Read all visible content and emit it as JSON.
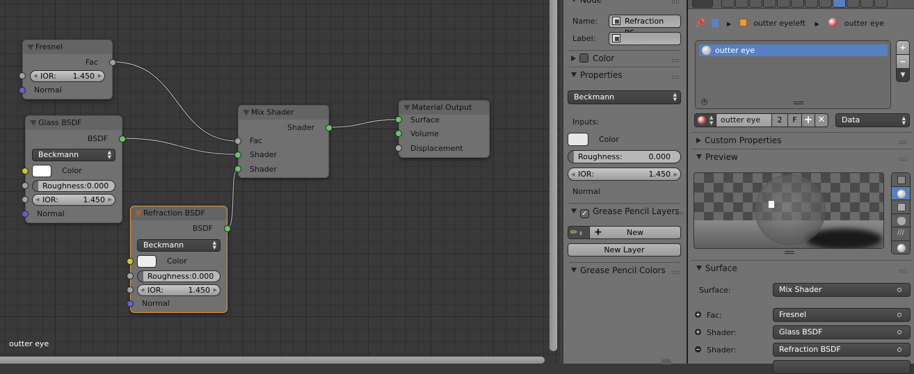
{
  "editor": {
    "material_label": "outter eye",
    "nodes": {
      "fresnel": {
        "title": "Fresnel",
        "out_fac": "Fac",
        "ior_label": "IOR:",
        "ior_value": "1.450",
        "normal": "Normal"
      },
      "glass": {
        "title": "Glass BSDF",
        "out": "BSDF",
        "distribution": "Beckmann",
        "color_label": "Color",
        "color": "#ffffff",
        "roughness_label": "Roughness:",
        "roughness_value": "0.000",
        "ior_label": "IOR:",
        "ior_value": "1.450",
        "normal": "Normal"
      },
      "refraction": {
        "title": "Refraction BSDF",
        "out": "BSDF",
        "distribution": "Beckmann",
        "color_label": "Color",
        "color": "#eeeeee",
        "roughness_label": "Roughness:",
        "roughness_value": "0.000",
        "ior_label": "IOR:",
        "ior_value": "1.450",
        "normal": "Normal"
      },
      "mix": {
        "title": "Mix Shader",
        "out": "Shader",
        "in_fac": "Fac",
        "in_shader1": "Shader",
        "in_shader2": "Shader"
      },
      "output": {
        "title": "Material Output",
        "surface": "Surface",
        "volume": "Volume",
        "displacement": "Displacement"
      }
    },
    "socket_colors": {
      "shader": "#63c763",
      "float": "#a1a1a1",
      "color": "#c7c729",
      "vector": "#6363c7"
    },
    "active_node_color": "#e89a3c"
  },
  "node_panel": {
    "section_node": "Node",
    "name_label": "Name:",
    "name_value": "Refraction BS...",
    "label_label": "Label:",
    "label_value": "",
    "section_color": "Color",
    "section_properties": "Properties",
    "distribution": "Beckmann",
    "inputs_label": "Inputs:",
    "color_label": "Color",
    "roughness_label": "Roughness:",
    "roughness_value": "0.000",
    "ior_label": "IOR:",
    "ior_value": "1.450",
    "normal_label": "Normal",
    "section_gp_layers": "Grease Pencil Layers",
    "gp_layers_checked": true,
    "new_button": "New",
    "new_layer_button": "New Layer",
    "section_gp_colors": "Grease Pencil Colors"
  },
  "properties": {
    "breadcrumb": [
      "outter eyeleft",
      "outter eye"
    ],
    "material_slots": [
      {
        "name": "outter eye",
        "selected": true
      }
    ],
    "material_name": "outter eye",
    "users": "2",
    "fake_user": "F",
    "link_mode": "Data",
    "section_custom": "Custom Properties",
    "section_preview": "Preview",
    "section_surface": "Surface",
    "surface_label": "Surface:",
    "surface_value": "Mix Shader",
    "inputs": [
      {
        "label": "Fac:",
        "value": "Fresnel",
        "expand": "+"
      },
      {
        "label": "Shader:",
        "value": "Glass BSDF",
        "expand": "+"
      },
      {
        "label": "Shader:",
        "value": "Refraction BSDF",
        "expand": "−"
      }
    ],
    "accent_color": "#5680c2"
  }
}
